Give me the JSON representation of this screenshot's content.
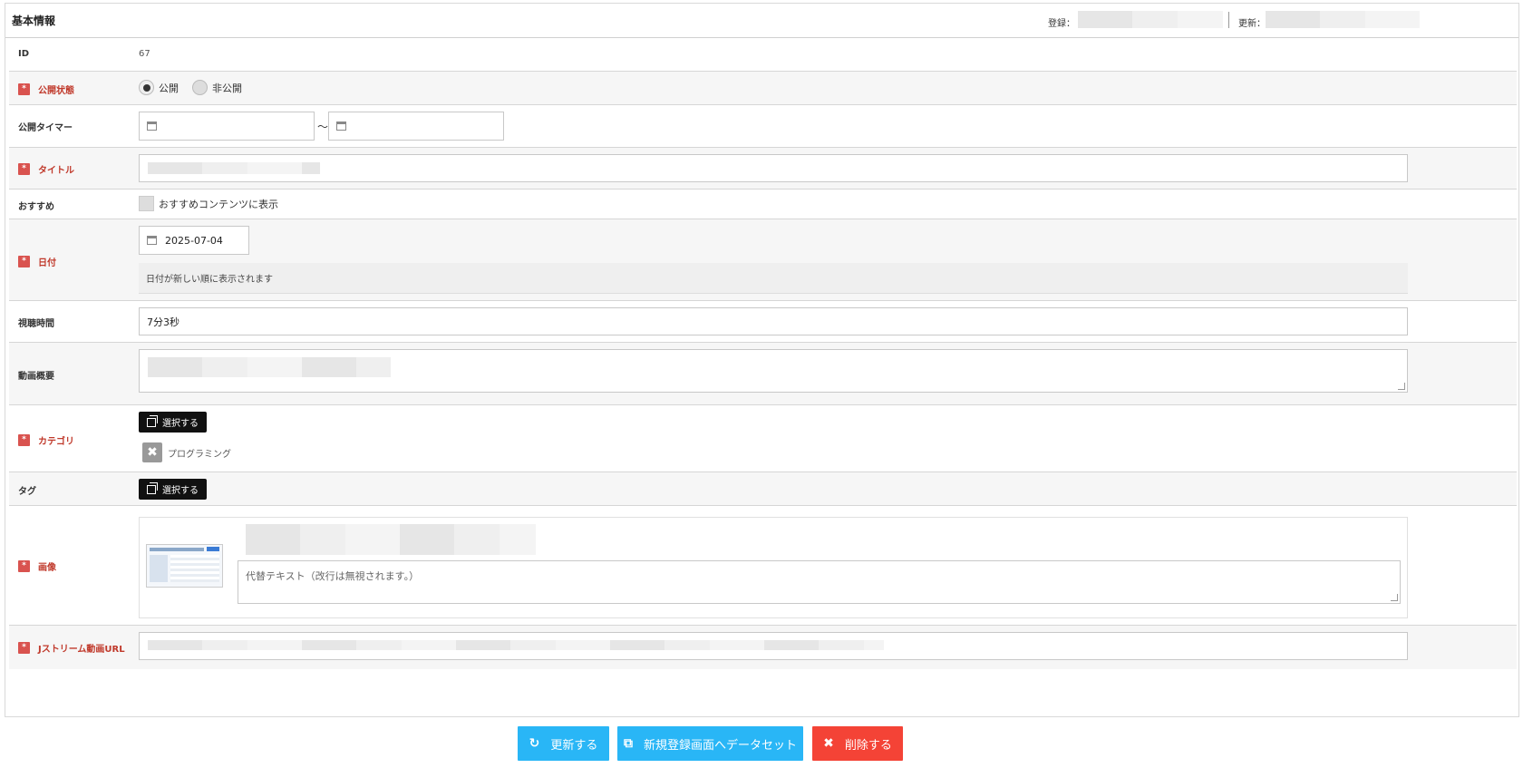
{
  "header": {
    "title": "基本情報",
    "registered_label": "登録：",
    "updated_label": "更新："
  },
  "fields": {
    "id": {
      "label": "ID",
      "value": "67"
    },
    "status": {
      "label": "公開状態",
      "options": [
        "公開",
        "非公開"
      ],
      "selected": "公開"
    },
    "timer": {
      "label": "公開タイマー",
      "separator": "～",
      "start": "",
      "end": ""
    },
    "title": {
      "label": "タイトル",
      "value": ""
    },
    "recommend": {
      "label": "おすすめ",
      "checkbox_label": "おすすめコンテンツに表示",
      "checked": false
    },
    "date": {
      "label": "日付",
      "value": "2025-07-04",
      "note": "日付が新しい順に表示されます"
    },
    "duration": {
      "label": "視聴時間",
      "value": "7分3秒"
    },
    "summary": {
      "label": "動画概要",
      "value": ""
    },
    "category": {
      "label": "カテゴリ",
      "select_button": "選択する",
      "selected": [
        "プログラミング"
      ]
    },
    "tag": {
      "label": "タグ",
      "select_button": "選択する"
    },
    "image": {
      "label": "画像",
      "alt_placeholder": "代替テキスト（改行は無視されます。）"
    },
    "video_url": {
      "label": "Jストリーム動画URL",
      "value": ""
    }
  },
  "actions": {
    "update": "更新する",
    "copy_to_new": "新規登録画面へデータセット",
    "delete": "削除する"
  },
  "colors": {
    "required": "#d9534f",
    "primary": "#29b6f6",
    "danger": "#f44336"
  }
}
